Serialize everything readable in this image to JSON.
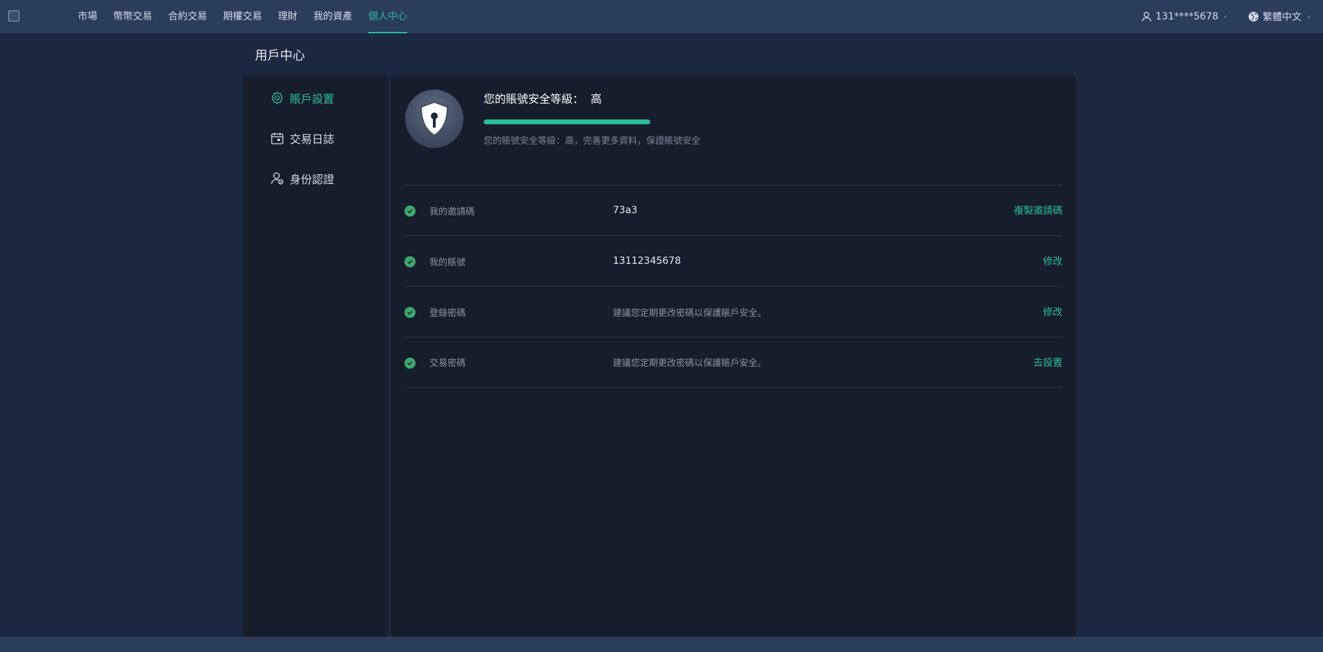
{
  "colors": {
    "accent": "#2bbd97",
    "topbar_bg": "#2a3d5a",
    "page_bg": "#1b2940",
    "panel_bg": "#161e2d",
    "check_green": "#3da86d"
  },
  "nav": {
    "items": [
      {
        "label": "市場"
      },
      {
        "label": "幣幣交易"
      },
      {
        "label": "合約交易"
      },
      {
        "label": "期權交易"
      },
      {
        "label": "理財"
      },
      {
        "label": "我的資產"
      },
      {
        "label": "個人中心",
        "active": true
      }
    ],
    "user": {
      "label": "131****5678",
      "icon": "user-icon"
    },
    "language": {
      "label": "繁體中文",
      "icon": "globe-icon"
    }
  },
  "page": {
    "title": "用戶中心"
  },
  "sidebar": {
    "items": [
      {
        "label": "賬戶設置",
        "icon": "gear-icon",
        "active": true
      },
      {
        "label": "交易日誌",
        "icon": "calendar-icon"
      },
      {
        "label": "身份認證",
        "icon": "user-verify-icon"
      }
    ]
  },
  "security": {
    "title": "您的賬號安全等級：",
    "level": "高",
    "progress": 1.0,
    "description": "您的賬號安全等級：高，完善更多資料，保證賬號安全",
    "icon": "shield-lock-icon"
  },
  "rows": [
    {
      "label": "我的邀請碼",
      "value": "73a3",
      "action": "複製邀請碼"
    },
    {
      "label": "我的賬號",
      "value": "13112345678",
      "action": "修改"
    },
    {
      "label": "登錄密碼",
      "value": "建議您定期更改密碼以保護賬戶安全。",
      "action": "修改"
    },
    {
      "label": "交易密碼",
      "value": "建議您定期更改密碼以保護賬戶安全。",
      "action": "去設置"
    }
  ]
}
